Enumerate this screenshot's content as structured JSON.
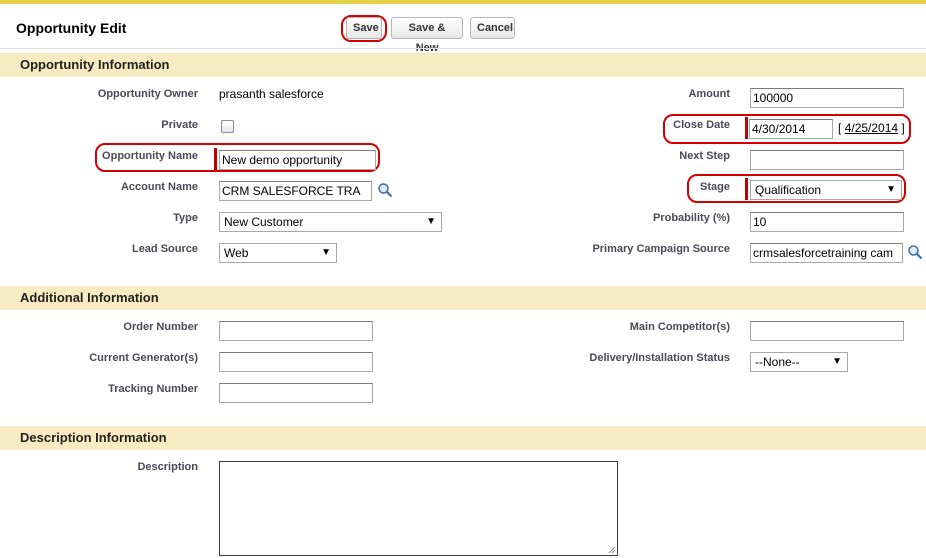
{
  "header": {
    "title": "Opportunity Edit",
    "save_label": "Save",
    "save_new_label": "Save & New",
    "cancel_label": "Cancel"
  },
  "sections": {
    "opportunity_info": "Opportunity Information",
    "additional_info": "Additional Information",
    "description_info": "Description Information"
  },
  "opportunity": {
    "owner_label": "Opportunity Owner",
    "owner_value": "prasanth salesforce",
    "private_label": "Private",
    "name_label": "Opportunity Name",
    "name_value": "New demo opportunity",
    "account_label": "Account Name",
    "account_value": "CRM SALESFORCE TRA",
    "type_label": "Type",
    "type_value": "New Customer",
    "lead_source_label": "Lead Source",
    "lead_source_value": "Web",
    "amount_label": "Amount",
    "amount_value": "100000",
    "close_date_label": "Close Date",
    "close_date_value": "4/30/2014",
    "close_date_bracket_open": "[",
    "today_link": "4/25/2014",
    "close_date_bracket_close": "]",
    "next_step_label": "Next Step",
    "next_step_value": "",
    "stage_label": "Stage",
    "stage_value": "Qualification",
    "probability_label": "Probability (%)",
    "probability_value": "10",
    "campaign_label": "Primary Campaign Source",
    "campaign_value": "crmsalesforcetraining cam"
  },
  "additional": {
    "order_number_label": "Order Number",
    "order_number_value": "",
    "current_generator_label": "Current Generator(s)",
    "current_generator_value": "",
    "tracking_number_label": "Tracking Number",
    "tracking_number_value": "",
    "main_competitor_label": "Main Competitor(s)",
    "main_competitor_value": "",
    "delivery_status_label": "Delivery/Installation Status",
    "delivery_status_value": "--None--"
  },
  "description": {
    "label": "Description",
    "value": ""
  },
  "colors": {
    "section_bg": "#f8ebc2",
    "required_bar": "#c00000",
    "callout": "#d40000",
    "top_border": "#e8d14a"
  },
  "icons": {
    "lookup": "magnifier-icon",
    "dropdown": "chevron-down-icon"
  }
}
